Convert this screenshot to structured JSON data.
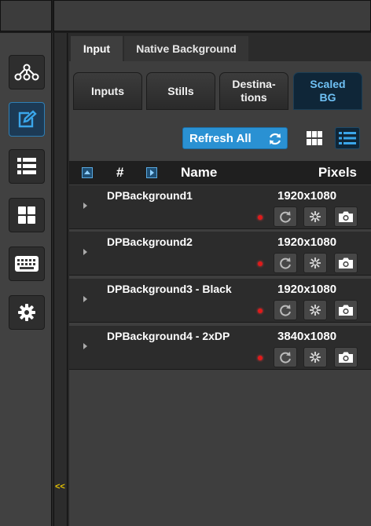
{
  "tabs": [
    {
      "label": "Input",
      "active": true
    },
    {
      "label": "Native Background",
      "active": false
    }
  ],
  "subtabs": [
    {
      "label": "Inputs",
      "active": false
    },
    {
      "label": "Stills",
      "active": false
    },
    {
      "label": "Destina-\ntions",
      "active": false
    },
    {
      "label": "Scaled\nBG",
      "active": true
    }
  ],
  "toolbar": {
    "refresh_label": "Refresh All",
    "view_mode": "list"
  },
  "table": {
    "columns": {
      "index": "#",
      "name": "Name",
      "pixels": "Pixels"
    },
    "rows": [
      {
        "name": "DPBackground1",
        "pixels": "1920x1080",
        "status": "red"
      },
      {
        "name": "DPBackground2",
        "pixels": "1920x1080",
        "status": "red"
      },
      {
        "name": "DPBackground3 - Black",
        "pixels": "1920x1080",
        "status": "red"
      },
      {
        "name": "DPBackground4 - 2xDP",
        "pixels": "3840x1080",
        "status": "red"
      }
    ]
  },
  "sidebar": {
    "items": [
      {
        "icon": "network-tree-icon",
        "active": false
      },
      {
        "icon": "edit-icon",
        "active": true
      },
      {
        "icon": "list-icon",
        "active": false
      },
      {
        "icon": "grid-icon",
        "active": false
      },
      {
        "icon": "keyboard-icon",
        "active": false
      },
      {
        "icon": "gear-icon",
        "active": false
      }
    ]
  },
  "collapse_label": "<<",
  "colors": {
    "accent": "#2a91d3",
    "active_tab_text": "#6fc1f5",
    "status_red": "#e01a1a",
    "collapse_yellow": "#e8c400"
  }
}
